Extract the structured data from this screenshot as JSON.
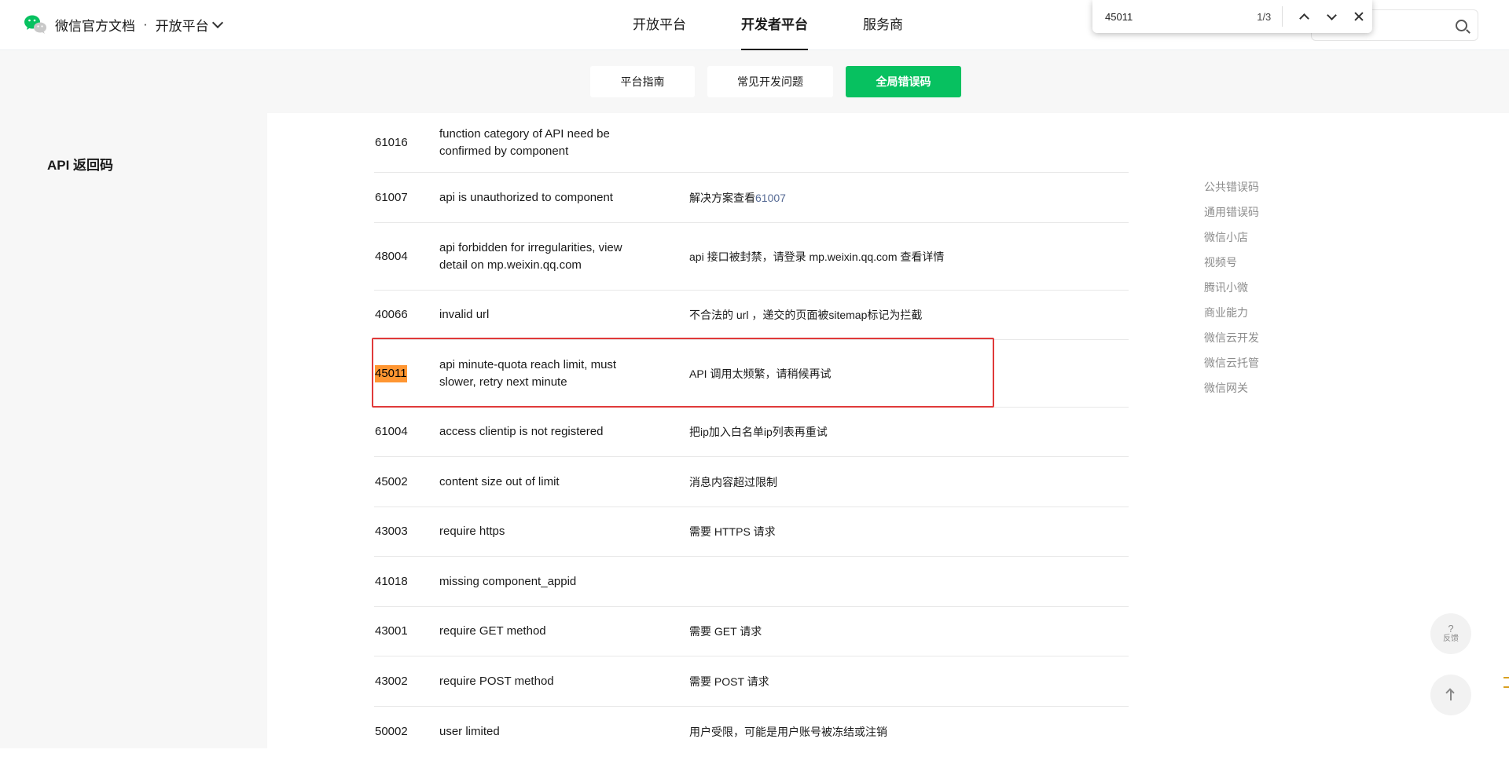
{
  "nav": {
    "brand": "微信官方文档",
    "separator": "·",
    "platform": "开放平台",
    "tabs": [
      "开放平台",
      "开发者平台",
      "服务商"
    ],
    "active_tab": "开发者平台"
  },
  "find_bar": {
    "query": "45011",
    "count": "1/3"
  },
  "subheader": {
    "buttons": [
      "平台指南",
      "常见开发问题",
      "全局错误码"
    ],
    "active_button": "全局错误码"
  },
  "sidebar": {
    "title": "API 返回码"
  },
  "table": {
    "rows": [
      {
        "code": "61016",
        "message": "function category of API need be confirmed by component",
        "desc": ""
      },
      {
        "code": "61007",
        "message": "api is unauthorized to component",
        "desc": "解决方案查看",
        "link": "61007"
      },
      {
        "code": "48004",
        "message": "api forbidden for irregularities, view detail on mp.weixin.qq.com",
        "desc": "api 接口被封禁，请登录 mp.weixin.qq.com 查看详情"
      },
      {
        "code": "40066",
        "message": "invalid url",
        "desc": "不合法的 url ，递交的页面被sitemap标记为拦截"
      },
      {
        "code": "45011",
        "message": "api minute-quota reach limit, must slower, retry next minute",
        "desc": "API 调用太频繁，请稍候再试"
      },
      {
        "code": "61004",
        "message": "access clientip is not registered",
        "desc": "把ip加入白名单ip列表再重试"
      },
      {
        "code": "45002",
        "message": "content size out of limit",
        "desc": "消息内容超过限制"
      },
      {
        "code": "43003",
        "message": "require https",
        "desc": "需要 HTTPS 请求"
      },
      {
        "code": "41018",
        "message": "missing component_appid",
        "desc": ""
      },
      {
        "code": "43001",
        "message": "require GET method",
        "desc": "需要 GET 请求"
      },
      {
        "code": "43002",
        "message": "require POST method",
        "desc": "需要 POST 请求"
      },
      {
        "code": "50002",
        "message": "user limited",
        "desc": "用户受限，可能是用户账号被冻结或注销"
      }
    ]
  },
  "toc": {
    "items": [
      "公共错误码",
      "通用错误码",
      "微信小店",
      "视频号",
      "腾讯小微",
      "商业能力",
      "微信云开发",
      "微信云托管",
      "微信网关"
    ]
  },
  "floating": {
    "feedback_icon": "?",
    "feedback_label": "反馈"
  },
  "colors": {
    "accent_green": "#07c160",
    "highlight_orange": "#ff9632",
    "annotation_red": "#e03a3a",
    "link": "#576b95"
  }
}
